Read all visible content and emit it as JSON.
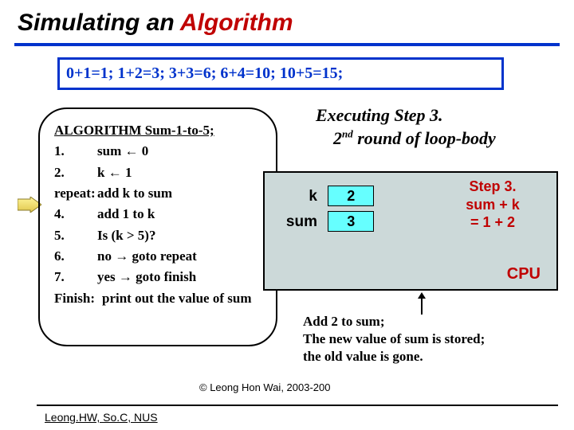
{
  "title": {
    "plain": "Simulating an ",
    "accent": "Algorithm"
  },
  "equation": "0+1=1;  1+2=3;  3+3=6;  6+4=10;  10+5=15;",
  "algo": {
    "heading": "ALGORITHM Sum-1-to-5;",
    "r1n": "1.",
    "r1t": "sum ← 0",
    "r2n": "2.",
    "r2t": "k ← 1",
    "r3n": "repeat:",
    "r3t": "add k to sum",
    "r4n": "4.",
    "r4t": "add 1 to k",
    "r5n": "5.",
    "r5t": "Is (k > 5)?",
    "r6n": "6.",
    "r6t": " no → goto repeat",
    "r7n": "7.",
    "r7t": " yes → goto finish",
    "r8n": "Finish:",
    "r8t": "print out the value of sum"
  },
  "exec": {
    "line1": "Executing Step 3.",
    "line2a": "2",
    "line2sup": "nd",
    "line2b": " round of loop-body"
  },
  "kv": {
    "klabel": "k",
    "kval": "2",
    "sumlabel": "sum",
    "sumval": "3"
  },
  "stepnote": {
    "l1": "Step 3.",
    "l2": "sum + k",
    "l3": "= 1 + 2"
  },
  "cpu": "CPU",
  "addnote": {
    "l1": "Add 2 to sum;",
    "l2": "The new value of sum is stored;",
    "l3": "the old value is gone."
  },
  "footer": {
    "left": "Leong.HW, So.C, NUS",
    "center": "© Leong Hon Wai, 2003-200"
  }
}
